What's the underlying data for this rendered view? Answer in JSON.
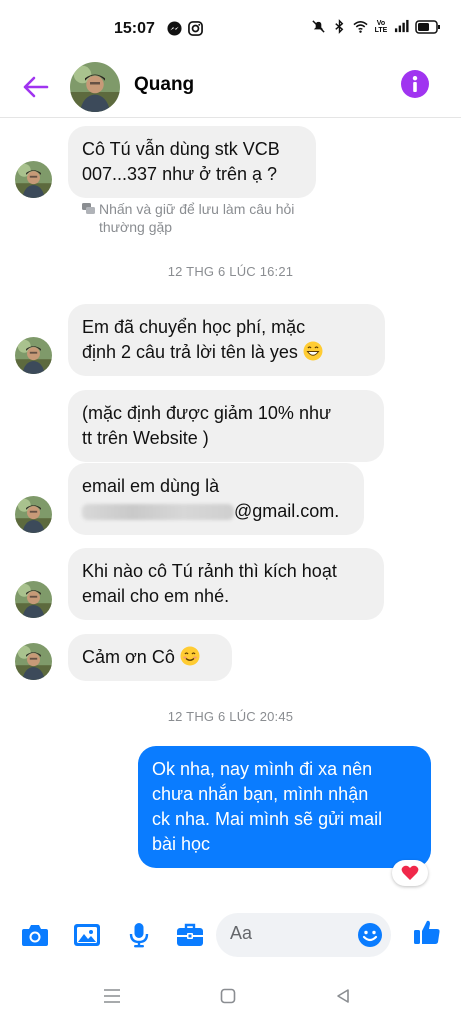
{
  "status_bar": {
    "time": "15:07",
    "left_icons": [
      "messenger-icon",
      "instagram-icon"
    ],
    "right_icons": [
      "mute-icon",
      "bluetooth-icon",
      "wifi-icon",
      "volte-icon",
      "signal-icon",
      "battery-icon"
    ],
    "volte_text": "Vo LTE"
  },
  "header": {
    "contact_name": "Quang",
    "accent_color": "#a034f0"
  },
  "messages": [
    {
      "direction": "in",
      "text_lines": [
        "Cô Tú vẫn dùng stk VCB",
        "007...337 như ở trên ạ ?"
      ]
    },
    {
      "type": "hint",
      "text_lines": [
        "Nhấn và giữ để lưu làm câu hỏi",
        "thường gặp"
      ]
    },
    {
      "type": "timestamp",
      "text": "12 THG 6 LÚC 16:21"
    },
    {
      "direction": "in",
      "text_lines": [
        "Em đã chuyển học phí, mặc",
        "định 2 câu trả lời tên là yes"
      ],
      "emoji": "grinning"
    },
    {
      "direction": "in",
      "text_lines": [
        "(mặc định được giảm 10% như",
        "tt trên Website )"
      ]
    },
    {
      "direction": "in",
      "text_lines": [
        "email em dùng là",
        "@gmail.com."
      ],
      "redacted": true
    },
    {
      "direction": "in",
      "text_lines": [
        "Khi nào cô Tú rảnh thì kích hoạt",
        "email cho em nhé."
      ]
    },
    {
      "direction": "in",
      "text_lines": [
        "Cảm ơn Cô"
      ],
      "emoji": "smiling"
    },
    {
      "type": "timestamp",
      "text": "12 THG 6 LÚC 20:45"
    },
    {
      "direction": "out",
      "text_lines": [
        "Ok nha, nay mình đi xa nên",
        "chưa nhắn bạn, mình nhận",
        "ck nha. Mai mình sẽ gửi mail",
        "bài học"
      ],
      "reaction": "heart"
    }
  ],
  "composer": {
    "placeholder": "Aa",
    "icons": [
      "camera-icon",
      "gallery-icon",
      "microphone-icon",
      "briefcase-icon",
      "emoji-icon",
      "thumbs-up-icon"
    ]
  },
  "colors": {
    "messenger_blue": "#0a7cff",
    "incoming_bubble": "#f0f0f0",
    "timestamp_gray": "#8a8d91"
  }
}
